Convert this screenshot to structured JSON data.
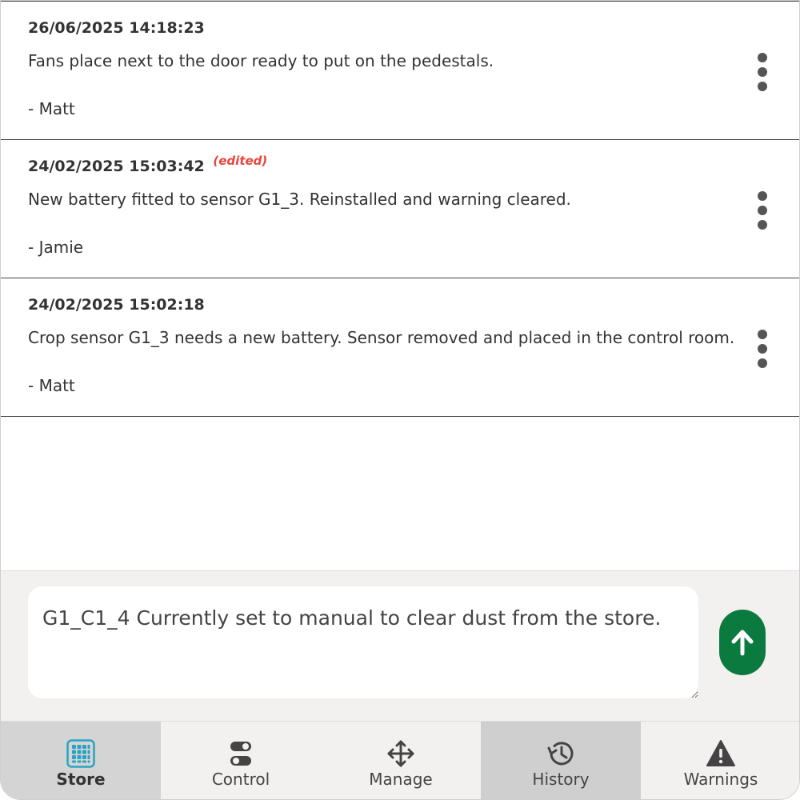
{
  "notes": [
    {
      "timestamp": "26/06/2025 14:18:23",
      "edited": "",
      "text": "Fans place next to the door ready to put on the pedestals.",
      "author": "- Matt"
    },
    {
      "timestamp": "24/02/2025 15:03:42",
      "edited": "(edited)",
      "text": "New battery fitted to sensor G1_3. Reinstalled and warning cleared.",
      "author": "- Jamie"
    },
    {
      "timestamp": "24/02/2025 15:02:18",
      "edited": "",
      "text": "Crop sensor G1_3 needs a new battery. Sensor removed and placed in the control room.",
      "author": "- Matt"
    }
  ],
  "composer": {
    "value": "G1_C1_4 Currently set to manual to clear dust from the store."
  },
  "tabs": [
    {
      "label": "Store",
      "icon": "grid-icon",
      "state": "active"
    },
    {
      "label": "Control",
      "icon": "toggles-icon",
      "state": ""
    },
    {
      "label": "Manage",
      "icon": "move-arrows-icon",
      "state": ""
    },
    {
      "label": "History",
      "icon": "history-icon",
      "state": "selected"
    },
    {
      "label": "Warnings",
      "icon": "warning-icon",
      "state": ""
    }
  ],
  "colors": {
    "accent_green": "#0b7a3f",
    "store_icon_teal": "#29a3c4",
    "edited_red": "#e8453c"
  }
}
